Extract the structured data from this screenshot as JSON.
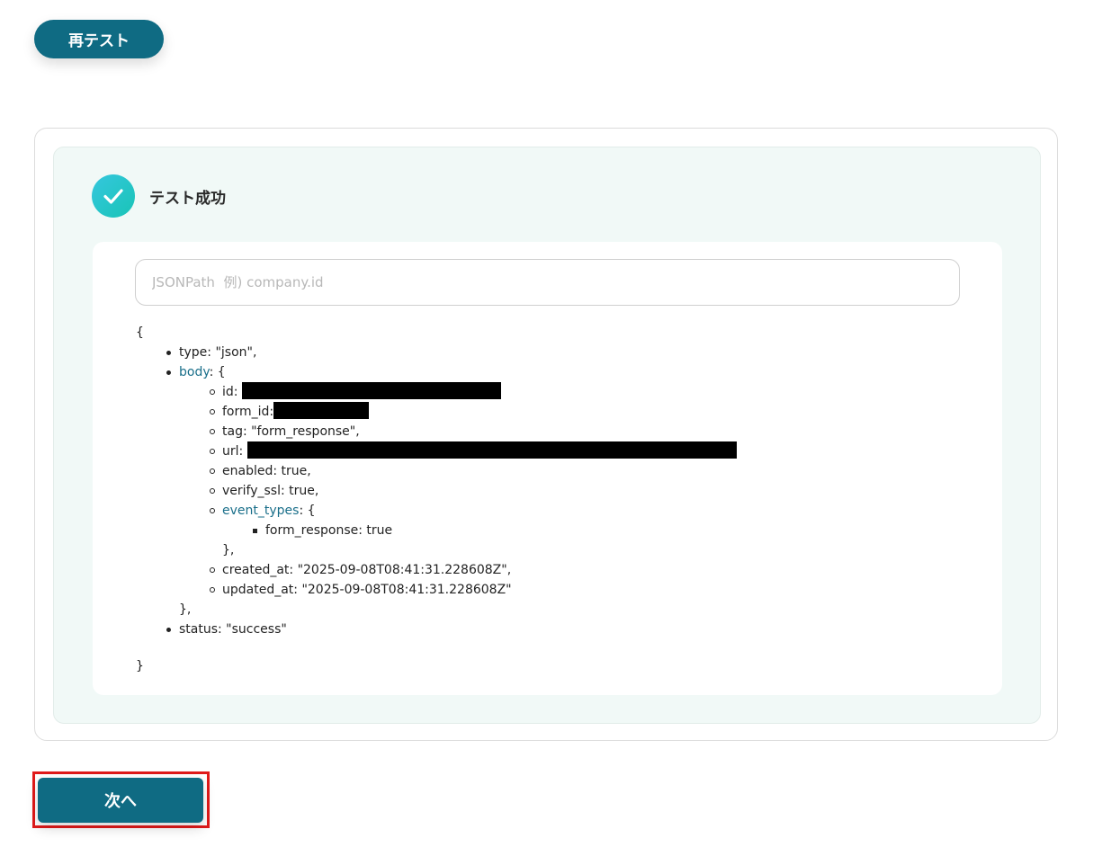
{
  "retest_button": {
    "label": "再テスト"
  },
  "result": {
    "status_icon": "check-circle-icon",
    "title": "テスト成功"
  },
  "jsonpath_input": {
    "placeholder": "JSONPath  例) company.id",
    "value": ""
  },
  "json_tree": {
    "open_brace": "{",
    "close_brace": "}",
    "type_line": "type: \"json\",",
    "body_key": "body",
    "body_open": ": {",
    "body_close": "},",
    "id_label": "id:",
    "form_id_label": "form_id:",
    "tag_line": "tag: \"form_response\",",
    "url_label": "url:",
    "enabled_line": "enabled: true,",
    "verify_ssl_line": "verify_ssl: true,",
    "event_types_key": "event_types",
    "event_types_open": ": {",
    "form_response_line": "form_response: true",
    "event_types_close": "},",
    "created_at_line": "created_at: \"2025-09-08T08:41:31.228608Z\",",
    "updated_at_line": "updated_at: \"2025-09-08T08:41:31.228608Z\"",
    "status_line": "status: \"success\""
  },
  "next_button": {
    "label": "次へ"
  },
  "colors": {
    "primary": "#0f6b83",
    "success_gradient_start": "#35c7de",
    "success_gradient_end": "#19c4b6",
    "panel_bg": "#f1f9f7",
    "json_key_link": "#1a6f8a",
    "highlight_outline": "#e01a1a"
  }
}
